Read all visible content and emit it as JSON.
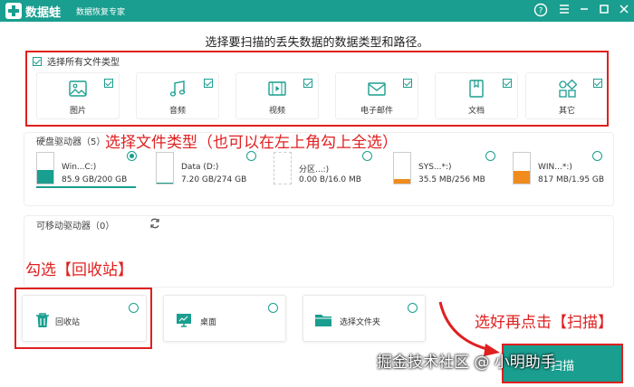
{
  "titlebar": {
    "app_name": "数据蛙",
    "subtitle": "数据恢复专家",
    "icons": [
      "help-icon",
      "menu-icon",
      "minimize-icon",
      "maximize-icon",
      "close-icon"
    ]
  },
  "instruction": "选择要扫描的丢失数据的数据类型和路径。",
  "select_all_label": "选择所有文件类型",
  "file_types": [
    {
      "label": "图片",
      "icon": "image-icon",
      "checked": true
    },
    {
      "label": "音频",
      "icon": "music-icon",
      "checked": true
    },
    {
      "label": "视频",
      "icon": "video-icon",
      "checked": true
    },
    {
      "label": "电子邮件",
      "icon": "mail-icon",
      "checked": true
    },
    {
      "label": "文档",
      "icon": "document-icon",
      "checked": true
    },
    {
      "label": "其它",
      "icon": "other-icon",
      "checked": true
    }
  ],
  "annotations": {
    "types_note": "选择文件类型（也可以在左上角勾上全选）",
    "recycle_note": "勾选【回收站】",
    "scan_note": "选好再点击【扫描】"
  },
  "hard_drives": {
    "title": "硬盘驱动器（5）",
    "items": [
      {
        "name": "Win...C:)",
        "size": "85.9 GB/200 GB",
        "selected": true,
        "fill_color": "#1a9e8f",
        "used_fraction": 0.43
      },
      {
        "name": "Data (D:)",
        "size": "7.20 GB/274 GB",
        "selected": false,
        "fill_color": "#1a9e8f",
        "used_fraction": 0.03
      },
      {
        "name": "分区...:)",
        "size": "0.00  B/16.0 MB",
        "selected": false,
        "fill_color": "#1a9e8f",
        "used_fraction": 0.0
      },
      {
        "name": "SYS...*:)",
        "size": "35.5 MB/256 MB",
        "selected": false,
        "fill_color": "#f08c1e",
        "used_fraction": 0.14
      },
      {
        "name": "WIN...*:)",
        "size": "817 MB/1.95 GB",
        "selected": false,
        "fill_color": "#f08c1e",
        "used_fraction": 0.42
      }
    ]
  },
  "removable": {
    "title": "可移动驱动器（0）",
    "refresh_icon": "refresh-icon"
  },
  "locations": [
    {
      "label": "回收站",
      "icon": "trash-icon"
    },
    {
      "label": "桌面",
      "icon": "desktop-icon"
    },
    {
      "label": "选择文件夹",
      "icon": "folder-icon"
    }
  ],
  "scan_button": "扫描",
  "watermark": "掘金技术社区 @ 小明助手",
  "colors": {
    "accent": "#1a9e8f",
    "annotation": "#e02020",
    "warning": "#f08c1e"
  }
}
